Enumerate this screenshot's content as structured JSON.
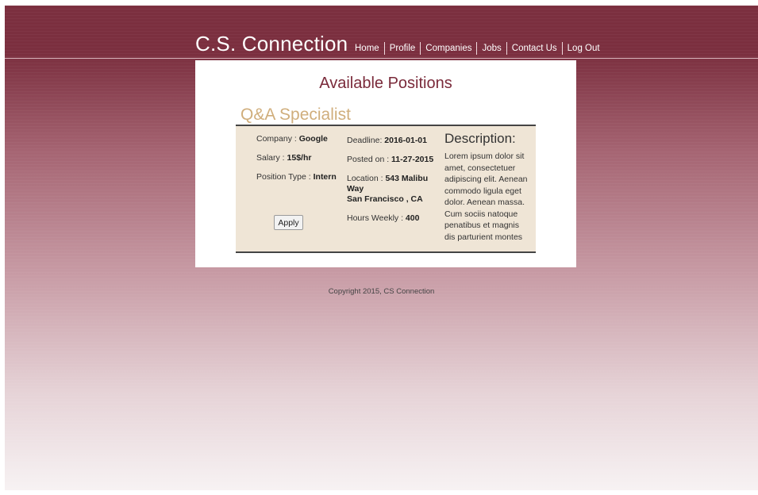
{
  "header": {
    "brand": "C.S. Connection",
    "nav": [
      "Home",
      "Profile",
      "Companies",
      "Jobs",
      "Contact Us",
      "Log Out"
    ]
  },
  "page": {
    "title": "Available Positions"
  },
  "job": {
    "title": "Q&A Specialist",
    "company_label": "Company : ",
    "company": "Google",
    "salary_label": "Salary : ",
    "salary": "15$/hr",
    "position_type_label": "Position Type : ",
    "position_type": "Intern",
    "apply_label": "Apply",
    "deadline_label": "Deadline: ",
    "deadline": "2016-01-01",
    "posted_label": "Posted on : ",
    "posted": "11-27-2015",
    "location_label": "Location : ",
    "location_line1": "543 Malibu Way",
    "location_line2": "San Francisco , CA",
    "hours_label": "Hours Weekly : ",
    "hours": "400",
    "description_title": "Description:",
    "description": "Lorem ipsum dolor sit amet, consectetuer adipiscing elit. Aenean commodo ligula eget dolor. Aenean massa. Cum sociis natoque penatibus et magnis dis parturient montes"
  },
  "footer": {
    "copyright": "Copyright 2015, CS Connection"
  },
  "colors": {
    "header": "#7b2f3f",
    "title": "#7a2a3a",
    "job_title": "#d0ae7c",
    "panel": "#efe5d6"
  }
}
